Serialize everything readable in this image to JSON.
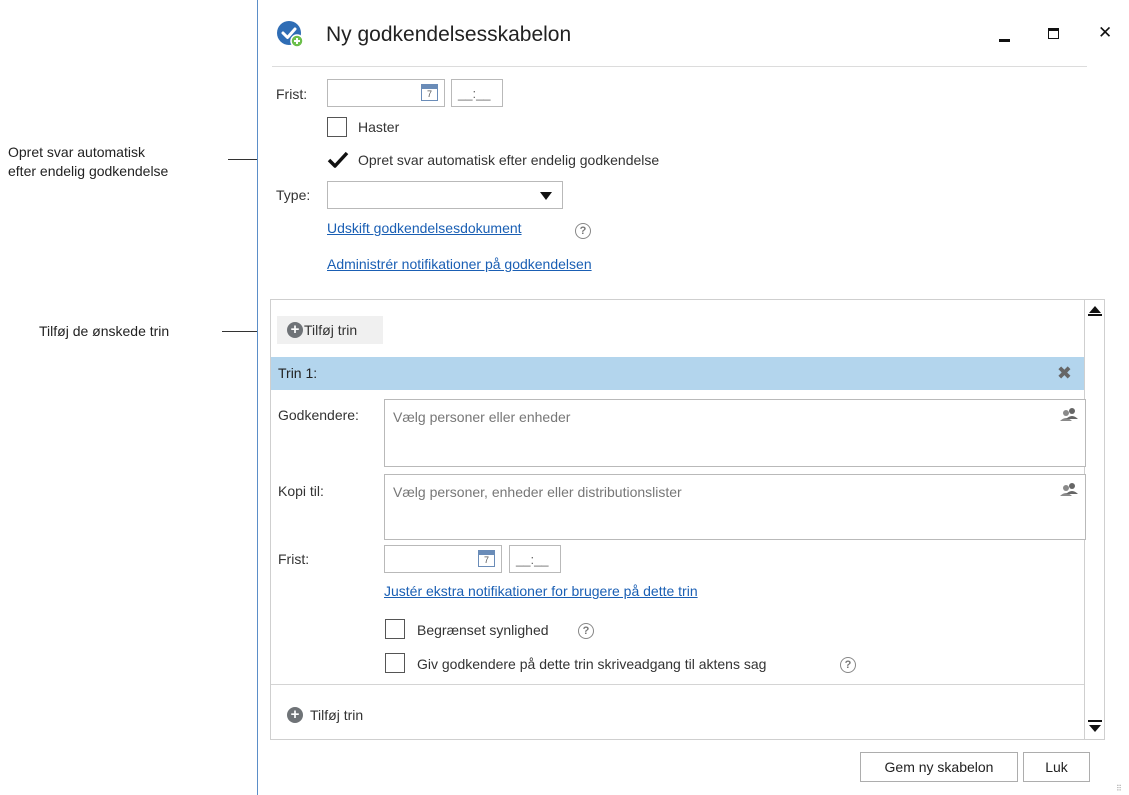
{
  "callouts": {
    "auto_reply": [
      "Opret svar automatisk",
      "efter endelig godkendelse"
    ],
    "add_steps": "Tilføj de ønskede trin"
  },
  "dialog": {
    "title": "Ny godkendelsesskabelon",
    "controls": {
      "minimize": "▁",
      "maximize": "▭",
      "close": "✕"
    },
    "deadline_label": "Frist:",
    "time_placeholder": "__:__",
    "urgent_label": "Haster",
    "urgent_checked": false,
    "auto_reply_label": "Opret svar automatisk efter endelig godkendelse",
    "auto_reply_checked": true,
    "type_label": "Type:",
    "type_value": "",
    "replace_doc_link": "Udskift godkendelsesdokument",
    "manage_notifications_link": "Administrér notifikationer på godkendelsen",
    "add_step_label": "Tilføj trin",
    "step": {
      "header": "Trin 1:",
      "approvers_label": "Godkendere:",
      "approvers_placeholder": "Vælg personer eller enheder",
      "copy_label": "Kopi til:",
      "copy_placeholder": "Vælg personer, enheder eller distributionslister",
      "deadline_label": "Frist:",
      "time_placeholder": "__:__",
      "extra_notifications_link": "Justér ekstra notifikationer for brugere på dette trin",
      "restricted_label": "Begrænset synlighed",
      "restricted_checked": false,
      "write_access_label": "Giv godkendere på dette trin skriveadgang til aktens sag",
      "write_access_checked": false
    },
    "add_step_bottom_label": "Tilføj trin",
    "save_button": "Gem ny skabelon",
    "close_button": "Luk"
  },
  "colors": {
    "accent": "#2f6db5",
    "step_header_bg": "#b3d5ed",
    "link": "#1a5fb4"
  }
}
